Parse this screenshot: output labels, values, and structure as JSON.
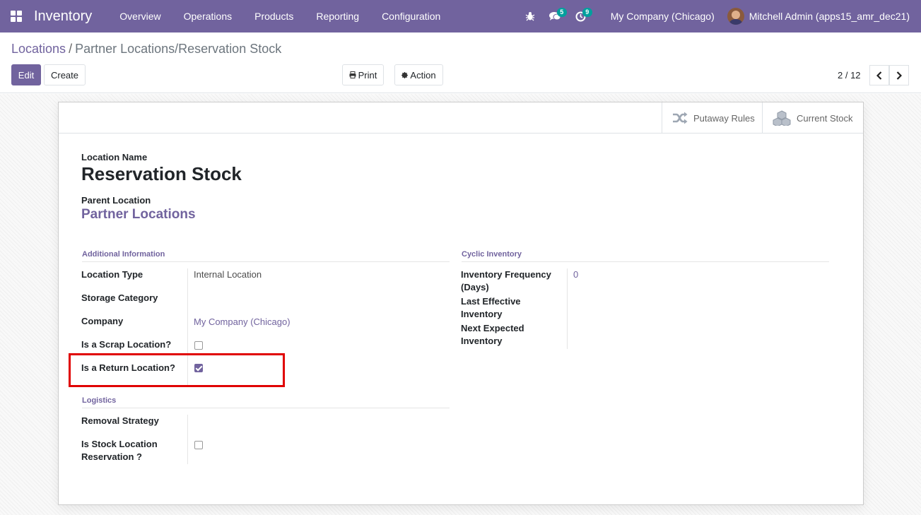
{
  "navbar": {
    "app_name": "Inventory",
    "menu": [
      "Overview",
      "Operations",
      "Products",
      "Reporting",
      "Configuration"
    ],
    "messages_count": "5",
    "activities_count": "9",
    "company": "My Company (Chicago)",
    "user": "Mitchell Admin (apps15_amr_dec21)"
  },
  "breadcrumb": {
    "parent": "Locations",
    "separator": "/",
    "current": "Partner Locations/Reservation Stock"
  },
  "toolbar": {
    "edit_label": "Edit",
    "create_label": "Create",
    "print_label": "Print",
    "action_label": "Action"
  },
  "pager": {
    "value": "2 / 12"
  },
  "smart_buttons": {
    "putaway_label": "Putaway Rules",
    "stock_label": "Current Stock"
  },
  "form": {
    "name_label": "Location Name",
    "name_value": "Reservation Stock",
    "parent_label": "Parent Location",
    "parent_value": "Partner Locations",
    "additional_title": "Additional Information",
    "location_type_label": "Location Type",
    "location_type_value": "Internal Location",
    "storage_category_label": "Storage Category",
    "company_label": "Company",
    "company_value": "My Company (Chicago)",
    "scrap_label": "Is a Scrap Location?",
    "scrap_checked": false,
    "return_label": "Is a Return Location?",
    "return_checked": true,
    "logistics_title": "Logistics",
    "removal_label": "Removal Strategy",
    "stock_res_label_1": "Is Stock Location",
    "stock_res_label_2": "Reservation ?",
    "stock_res_checked": false,
    "cyclic_title": "Cyclic Inventory",
    "freq_label_1": "Inventory Frequency",
    "freq_label_2": "(Days)",
    "freq_value": "0",
    "last_label_1": "Last Effective",
    "last_label_2": "Inventory",
    "next_label_1": "Next Expected",
    "next_label_2": "Inventory"
  },
  "colors": {
    "brand": "#71639e",
    "highlight": "#e00000"
  }
}
